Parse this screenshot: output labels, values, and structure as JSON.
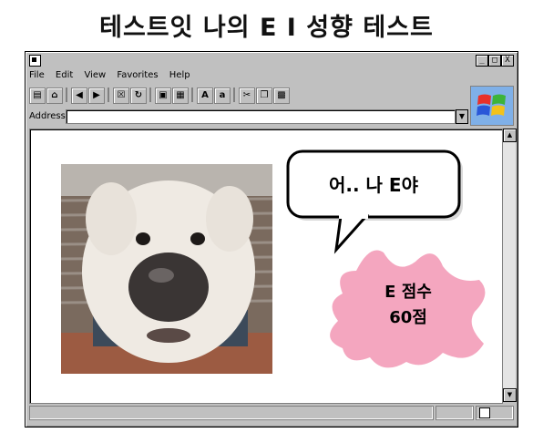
{
  "headline": "테스트잇 나의 E I 성향 테스트",
  "window": {
    "buttons": {
      "minimize": "_",
      "maximize": "□",
      "close": "X"
    },
    "menu": [
      "File",
      "Edit",
      "View",
      "Favorites",
      "Help"
    ],
    "address_label": "Address:",
    "address_value": ""
  },
  "content": {
    "speech_bubble": "어.. 나 E야",
    "score_label": "E 점수",
    "score_value": "60점"
  },
  "colors": {
    "window_gray": "#c0c0c0",
    "splash_pink": "#f4a6bf"
  }
}
